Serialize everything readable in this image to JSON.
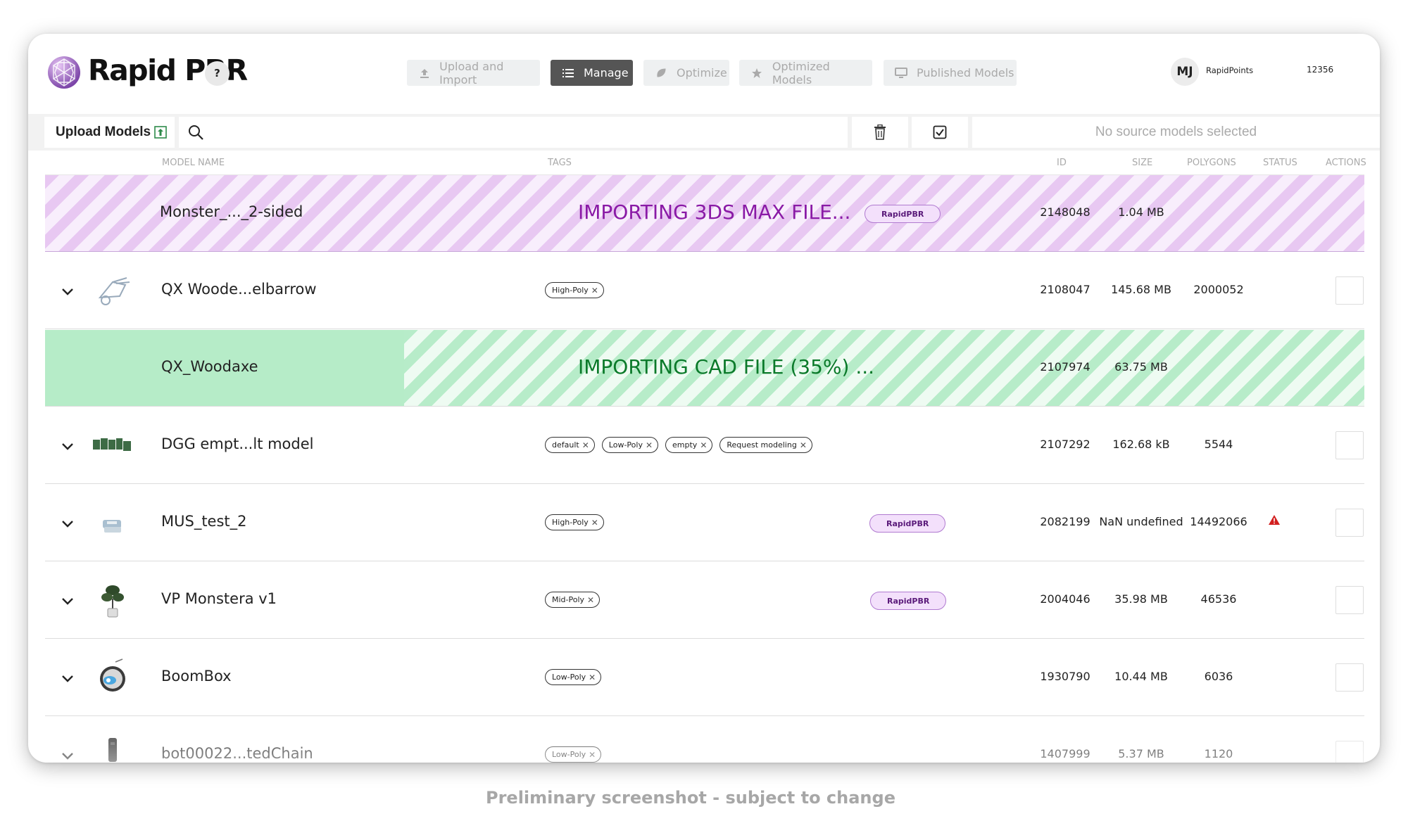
{
  "app": {
    "brand": "Rapid PBR",
    "help_label": "?"
  },
  "nav": [
    {
      "label": "Upload and Import",
      "icon": "upload-icon",
      "active": false
    },
    {
      "label": "Manage",
      "icon": "list-icon",
      "active": true
    },
    {
      "label": "Optimize",
      "icon": "leaf-icon",
      "active": false
    },
    {
      "label": "Optimized Models",
      "icon": "star-icon",
      "active": false
    },
    {
      "label": "Published Models",
      "icon": "monitor-icon",
      "active": false
    }
  ],
  "user": {
    "initials": "MJ",
    "points_label": "RapidPoints",
    "points_value": "12356"
  },
  "toolbar": {
    "upload_label": "Upload Models",
    "selection_status": "No source models selected"
  },
  "columns": {
    "name": "MODEL NAME",
    "tags": "TAGS",
    "id": "ID",
    "size": "SIZE",
    "polygons": "POLYGONS",
    "status": "STATUS",
    "actions": "ACTIONS"
  },
  "rows": [
    {
      "name": "Monster_..._2-sided",
      "importing": "IMPORTING 3DS MAX FILE...",
      "badge": "RapidPBR",
      "id": "2148048",
      "size": "1.04 MB",
      "polygons": "",
      "tags": []
    },
    {
      "name": "QX Woode...elbarrow",
      "tags": [
        "High-Poly"
      ],
      "id": "2108047",
      "size": "145.68 MB",
      "polygons": "2000052"
    },
    {
      "name": "QX_Woodaxe",
      "importing": "IMPORTING CAD FILE (35%) ...",
      "progress": 0.35,
      "id": "2107974",
      "size": "63.75 MB",
      "polygons": "",
      "tags": []
    },
    {
      "name": "DGG empt...lt model",
      "tags": [
        "default",
        "Low-Poly",
        "empty",
        "Request modeling"
      ],
      "id": "2107292",
      "size": "162.68 kB",
      "polygons": "5544"
    },
    {
      "name": "MUS_test_2",
      "tags": [
        "High-Poly"
      ],
      "badge": "RapidPBR",
      "id": "2082199",
      "size": "NaN undefined",
      "polygons": "14492066",
      "status": "warning-icon"
    },
    {
      "name": "VP Monstera v1",
      "tags": [
        "Mid-Poly"
      ],
      "badge": "RapidPBR",
      "id": "2004046",
      "size": "35.98 MB",
      "polygons": "46536"
    },
    {
      "name": "BoomBox",
      "tags": [
        "Low-Poly"
      ],
      "id": "1930790",
      "size": "10.44 MB",
      "polygons": "6036"
    },
    {
      "name": "bot00022...tedChain",
      "tags": [
        "Low-Poly"
      ],
      "id": "1407999",
      "size": "5.37 MB",
      "polygons": "1120"
    }
  ],
  "caption": "Preliminary screenshot - subject to change",
  "colors": {
    "active_nav": "#555555",
    "purple_stripe": "#e8c8f2",
    "green_stripe": "#b7ecc9",
    "purple_text": "#8a1aa6",
    "green_text": "#0b7a2a",
    "warning": "#d21f1f"
  }
}
